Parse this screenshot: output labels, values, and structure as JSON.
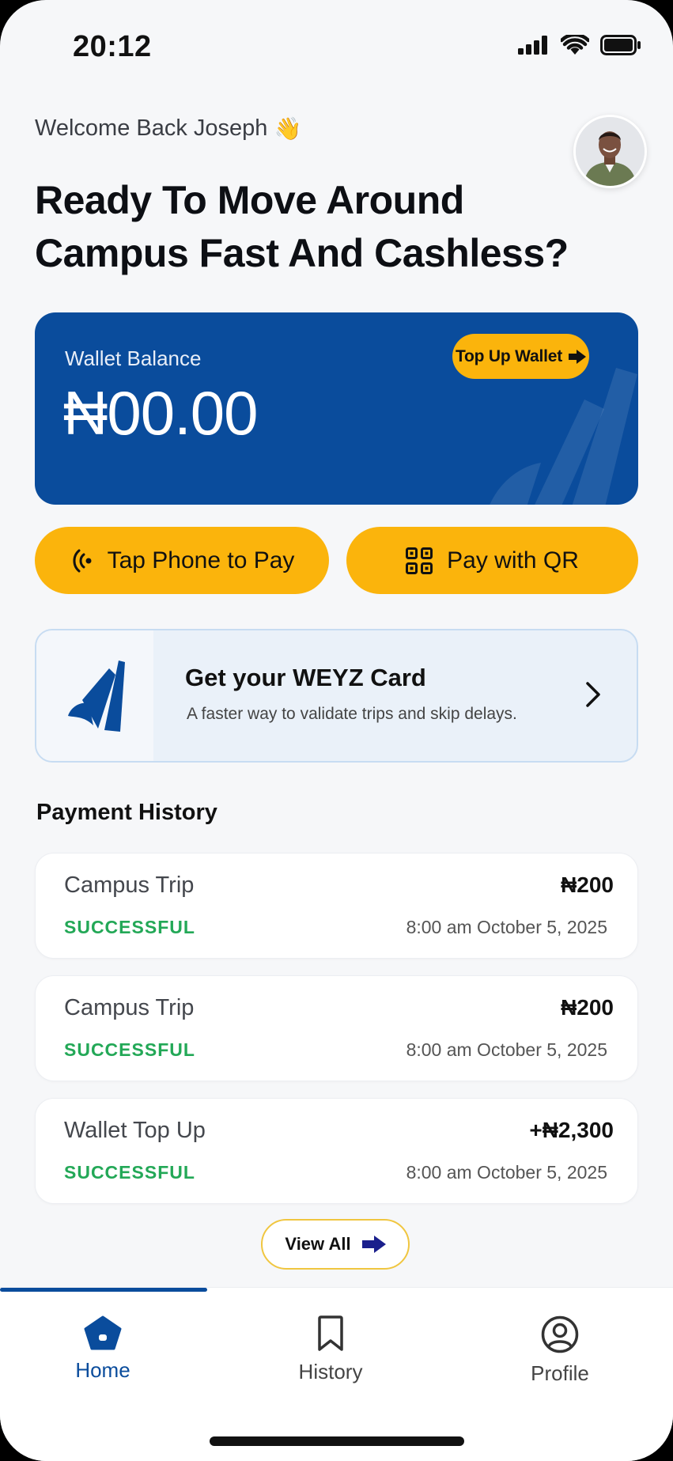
{
  "status_bar": {
    "time": "20:12"
  },
  "header": {
    "welcome": "Welcome Back Joseph",
    "wave_emoji": "👋",
    "headline_line1": "Ready To Move Around",
    "headline_line2": "Campus Fast And Cashless?"
  },
  "wallet": {
    "label": "Wallet Balance",
    "balance": "₦00.00",
    "topup_label": "Top Up Wallet"
  },
  "actions": {
    "tap_pay_label": "Tap Phone to Pay",
    "qr_pay_label": "Pay with QR"
  },
  "promo": {
    "title": "Get your WEYZ Card",
    "subtitle": "A faster way to validate trips and skip delays."
  },
  "history": {
    "title": "Payment History",
    "items": [
      {
        "title": "Campus Trip",
        "status": "SUCCESSFUL",
        "amount": "₦200",
        "date": "8:00 am October 5, 2025"
      },
      {
        "title": "Campus Trip",
        "status": "SUCCESSFUL",
        "amount": "₦200",
        "date": "8:00 am October 5, 2025"
      },
      {
        "title": "Wallet Top Up",
        "status": "SUCCESSFUL",
        "amount": "+₦2,300",
        "date": "8:00 am October 5, 2025"
      }
    ],
    "view_all_label": "View All"
  },
  "nav": {
    "home": "Home",
    "history": "History",
    "profile": "Profile"
  },
  "colors": {
    "primary_blue": "#0a4c9c",
    "accent_yellow": "#fbb40c",
    "success_green": "#23a857"
  }
}
